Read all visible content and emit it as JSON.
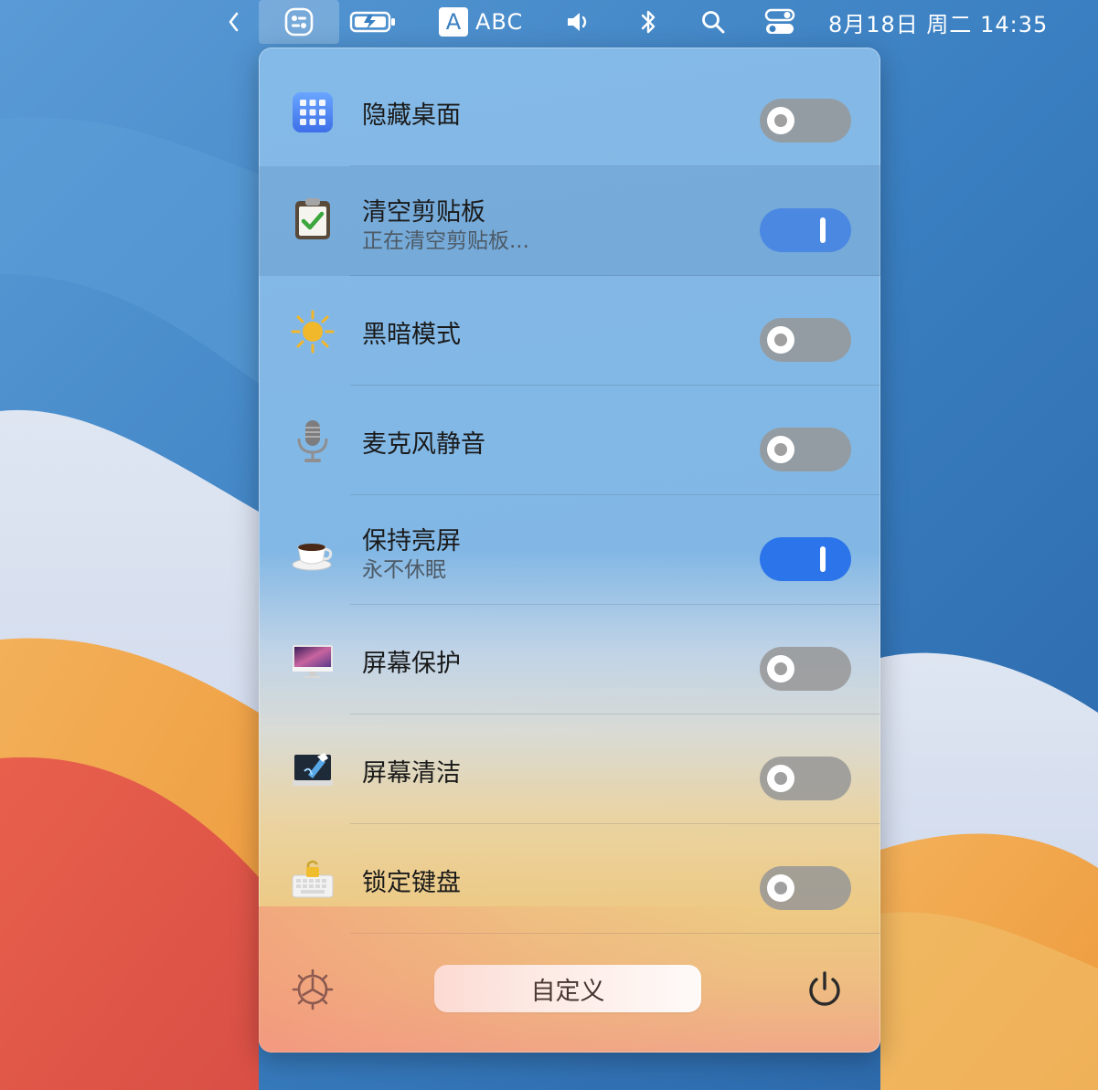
{
  "menubar": {
    "icons": [
      "chevron-left-icon",
      "app-switcher-icon",
      "battery-icon",
      "input-source-icon",
      "volume-icon",
      "bluetooth-icon",
      "search-icon",
      "control-center-icon"
    ],
    "input_letter": "A",
    "input_label": "ABC",
    "clock": "8月18日 周二  14:35"
  },
  "panel": {
    "rows": [
      {
        "title": "隐藏桌面",
        "subtitle": "",
        "icon": "apps-grid-icon",
        "toggle": "off"
      },
      {
        "title": "清空剪贴板",
        "subtitle": "正在清空剪贴板...",
        "icon": "clipboard-icon",
        "toggle": "on",
        "highlighted": true
      },
      {
        "title": "黑暗模式",
        "subtitle": "",
        "icon": "sun-icon",
        "toggle": "off"
      },
      {
        "title": "麦克风静音",
        "subtitle": "",
        "icon": "microphone-icon",
        "toggle": "off"
      },
      {
        "title": "保持亮屏",
        "subtitle": "永不休眠",
        "icon": "coffee-cup-icon",
        "toggle": "on"
      },
      {
        "title": "屏幕保护",
        "subtitle": "",
        "icon": "monitor-icon",
        "toggle": "off"
      },
      {
        "title": "屏幕清洁",
        "subtitle": "",
        "icon": "screen-cleaning-icon",
        "toggle": "off"
      },
      {
        "title": "锁定键盘",
        "subtitle": "",
        "icon": "keyboard-lock-icon",
        "toggle": "off"
      }
    ],
    "footer": {
      "customize_label": "自定义",
      "settings_icon": "gear-icon",
      "power_icon": "power-icon"
    }
  },
  "colors": {
    "toggle_on": "#2b74ea",
    "toggle_off": "#969696",
    "wallpaper_blue": "#2f6fb1",
    "wallpaper_orange": "#f0a64c",
    "wallpaper_red": "#e2574a"
  }
}
